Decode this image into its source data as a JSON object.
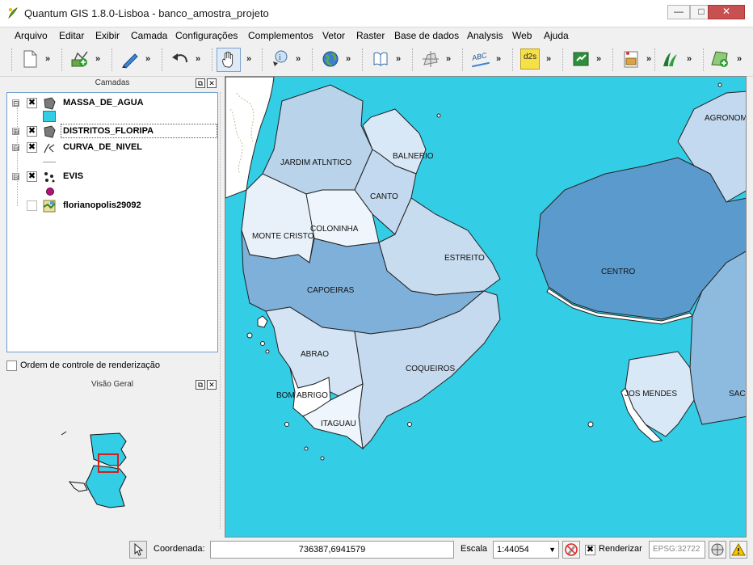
{
  "window": {
    "title": "Quantum GIS 1.8.0-Lisboa - banco_amostra_projeto",
    "minimize_symbol": "—",
    "maximize_symbol": "□",
    "close_symbol": "✕"
  },
  "menu": [
    "Arquivo",
    "Editar",
    "Exibir",
    "Camada",
    "Configurações",
    "Complementos",
    "Vetor",
    "Raster",
    "Base de dados",
    "Analysis",
    "Web",
    "Ajuda"
  ],
  "toolbar": {
    "more_glyph": "»",
    "icons": [
      "new-project-icon",
      "add-vector-layer-icon",
      "digitize-pencil-icon",
      "undo-icon",
      "pan-hand-icon",
      "identify-icon",
      "globe-icon",
      "help-book-icon",
      "move-feature-icon",
      "label-abc-icon",
      "decimal-degrees-icon",
      "plugin-icon",
      "raster-icon",
      "grass-icon",
      "georeferencer-icon"
    ],
    "text_labels": {
      "abc": "ABC",
      "d2s": "d2s"
    }
  },
  "layers_panel": {
    "title": "Camadas",
    "layers": [
      {
        "name": "MASSA_DE_AGUA",
        "checked": true,
        "expand": "⊟",
        "legend_color": "#33cde5"
      },
      {
        "name": "DISTRITOS_FLORIPA",
        "checked": true,
        "expand": "⊞"
      },
      {
        "name": "CURVA_DE_NIVEL",
        "checked": true,
        "expand": "⊟"
      },
      {
        "name": "EVIS",
        "checked": true,
        "expand": "⊟",
        "legend_color": "#b0127a"
      },
      {
        "name": "florianopolis29092",
        "checked": false,
        "expand": ""
      }
    ],
    "check_mark": "✖",
    "render_order_label": "Ordem de controle de renderização"
  },
  "overview_panel": {
    "title": "Visão Geral"
  },
  "map": {
    "water_color": "#33cde5",
    "labels": [
      "AGRONOMIC",
      "BALNERIO",
      "JARDIM ATLNTICO",
      "CANTO",
      "COLONINHA",
      "MONTE CRISTO",
      "ESTREITO",
      "CENTRO",
      "CAPOEIRAS",
      "ABRAO",
      "COQUEIROS",
      "BOM ABRIGO",
      "JOS MENDES",
      "SAC",
      "ITAGUAU"
    ]
  },
  "statusbar": {
    "coord_label": "Coordenada:",
    "coord_value": "736387,6941579",
    "scale_label": "Escala",
    "scale_value": "1:44054",
    "render_checked": true,
    "render_label": "Renderizar",
    "crs": "EPSG:32722"
  }
}
